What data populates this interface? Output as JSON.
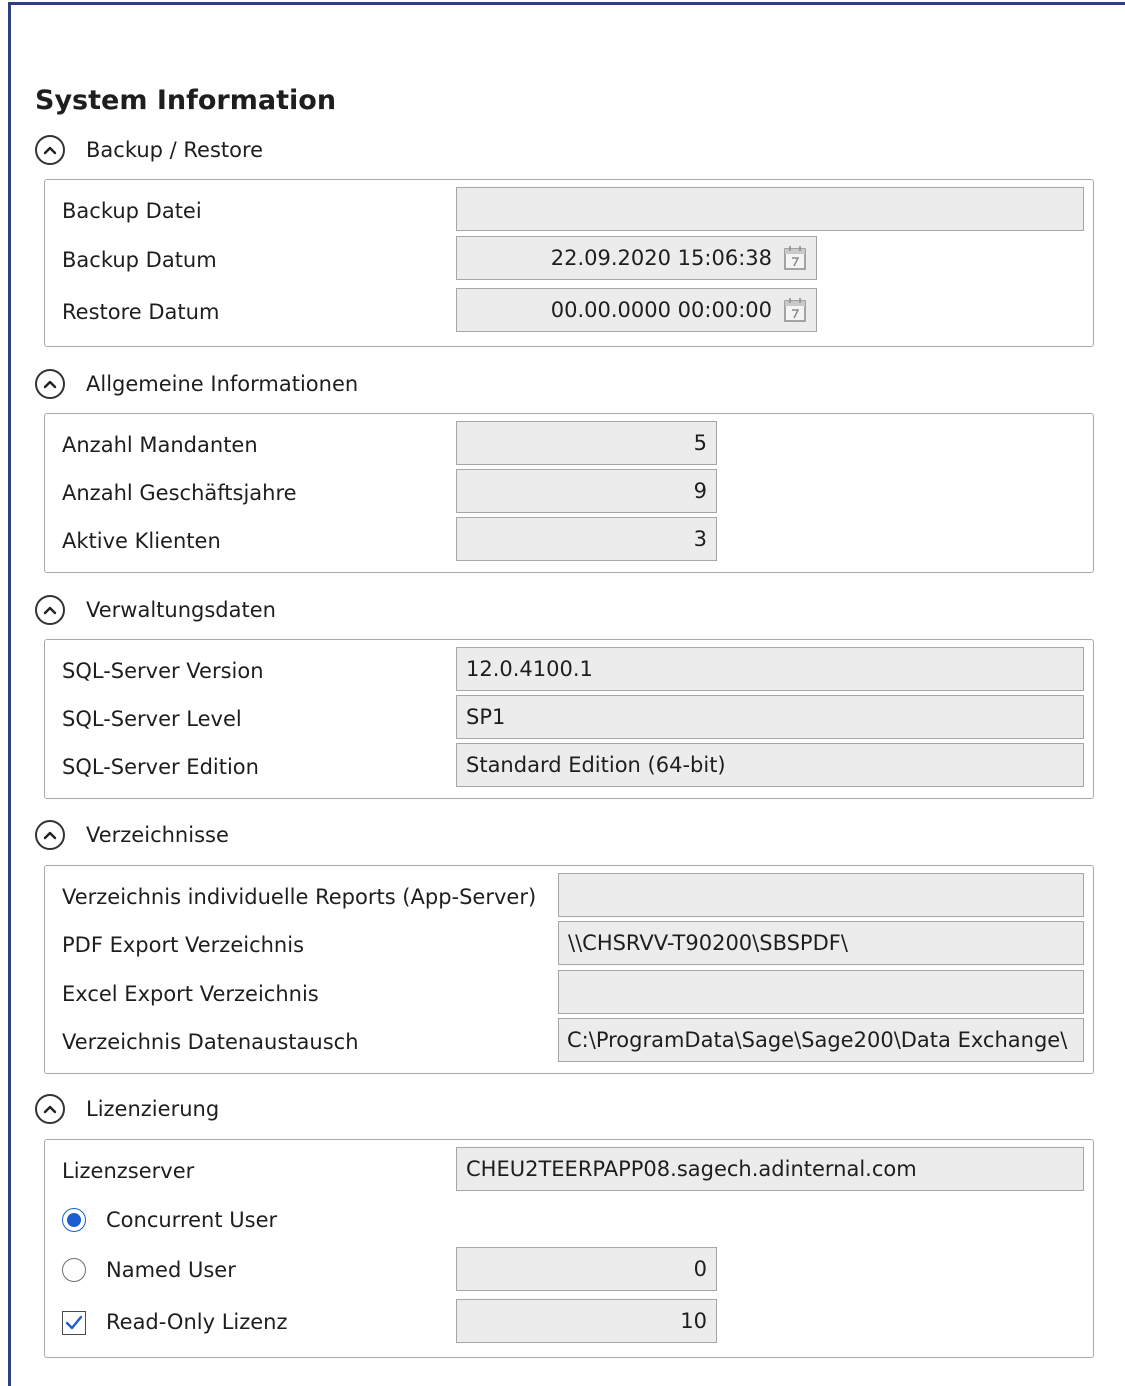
{
  "page": {
    "title": "System Information"
  },
  "sections": {
    "backup": {
      "title": "Backup / Restore",
      "backup_file_label": "Backup Datei",
      "backup_file_value": "",
      "backup_date_label": "Backup Datum",
      "backup_date_value": "22.09.2020 15:06:38",
      "restore_date_label": "Restore Datum",
      "restore_date_value": "00.00.0000 00:00:00"
    },
    "general": {
      "title": "Allgemeine Informationen",
      "clients_label": "Anzahl Mandanten",
      "clients_value": "5",
      "years_label": "Anzahl Geschäftsjahre",
      "years_value": "9",
      "active_label": "Aktive Klienten",
      "active_value": "3"
    },
    "admin": {
      "title": "Verwaltungsdaten",
      "version_label": "SQL-Server Version",
      "version_value": "12.0.4100.1",
      "level_label": "SQL-Server Level",
      "level_value": "SP1",
      "edition_label": "SQL-Server Edition",
      "edition_value": "Standard Edition (64-bit)"
    },
    "dirs": {
      "title": "Verzeichnisse",
      "reports_label": "Verzeichnis individuelle Reports (App-Server)",
      "reports_value": "",
      "pdf_label": "PDF Export Verzeichnis",
      "pdf_value": "\\\\CHSRVV-T90200\\SBSPDF\\",
      "excel_label": "Excel Export Verzeichnis",
      "excel_value": "",
      "exchange_label": "Verzeichnis Datenaustausch",
      "exchange_value": "C:\\ProgramData\\Sage\\Sage200\\Data Exchange\\"
    },
    "license": {
      "title": "Lizenzierung",
      "server_label": "Lizenzserver",
      "server_value": "CHEU2TEERPAPP08.sagech.adinternal.com",
      "concurrent_label": "Concurrent User",
      "concurrent_selected": true,
      "named_label": "Named User",
      "named_selected": false,
      "named_value": "0",
      "readonly_label": "Read-Only Lizenz",
      "readonly_checked": true,
      "readonly_value": "10"
    }
  },
  "icons": {
    "toggle": "chevron-up-icon",
    "calendar": "calendar-icon"
  },
  "colors": {
    "frame_border": "#2e3f7a",
    "field_bg": "#ececec",
    "accent": "#1a5fd0"
  }
}
